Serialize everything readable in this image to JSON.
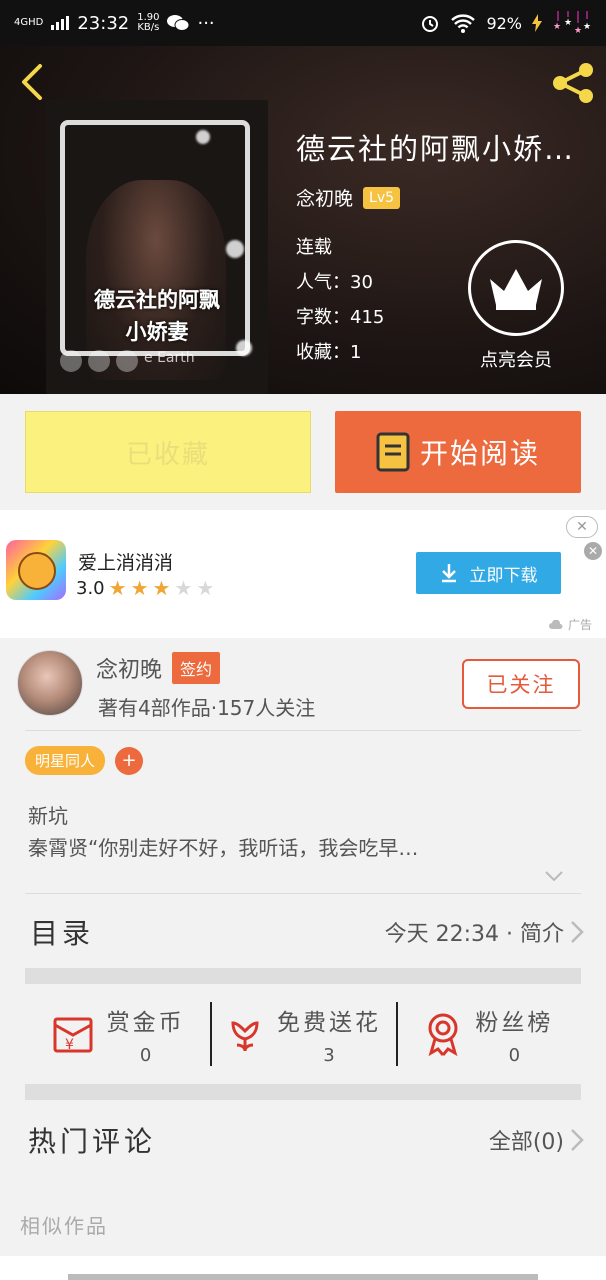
{
  "status_bar": {
    "network": "4GHD",
    "time": "23:32",
    "speed": "1.90",
    "speed_unit": "KB/s",
    "more": "···",
    "battery": "92%"
  },
  "book": {
    "title": "德云社的阿飘小娇…",
    "cover_title_line1": "德云社的阿飘",
    "cover_title_line2": "小娇妻",
    "cover_subtitle": "e Earth",
    "author": "念初晚",
    "author_level": "Lv5",
    "status": "连载",
    "popularity": "人气：30",
    "word_count": "字数：415",
    "favorites": "收藏：1"
  },
  "member": {
    "label": "点亮会员",
    "icon": "crown-icon"
  },
  "actions": {
    "favorited_label": "已收藏",
    "read_label": "开始阅读"
  },
  "ad": {
    "app_name": "爱上消消消",
    "rating": "3.0",
    "rating_stars": 3,
    "download_label": "立即下载",
    "tag": "广告",
    "close": "✕"
  },
  "author_card": {
    "name": "念初晚",
    "badge": "签约",
    "stats": "著有4部作品·157人关注",
    "follow_label": "已关注"
  },
  "tags": [
    "明星同人"
  ],
  "intro": {
    "line1": "新坑",
    "line2": "秦霄贤“你别走好不好，我听话，我会吃早…"
  },
  "toc": {
    "title": "目录",
    "update": "今天 22:34 · 简介"
  },
  "stats": [
    {
      "name": "赏金币",
      "value": "0",
      "icon": "envelope-coin-icon"
    },
    {
      "name": "免费送花",
      "value": "3",
      "icon": "flower-icon"
    },
    {
      "name": "粉丝榜",
      "value": "0",
      "icon": "medal-icon"
    }
  ],
  "hot_comments": {
    "title": "热门评论",
    "all": "全部(0)"
  },
  "similar": {
    "title": "相似作品"
  },
  "colors": {
    "accent": "#ec6a3e",
    "favorite_bg": "#faf17f",
    "download": "#30a9e5",
    "tag": "#f8b23a"
  }
}
